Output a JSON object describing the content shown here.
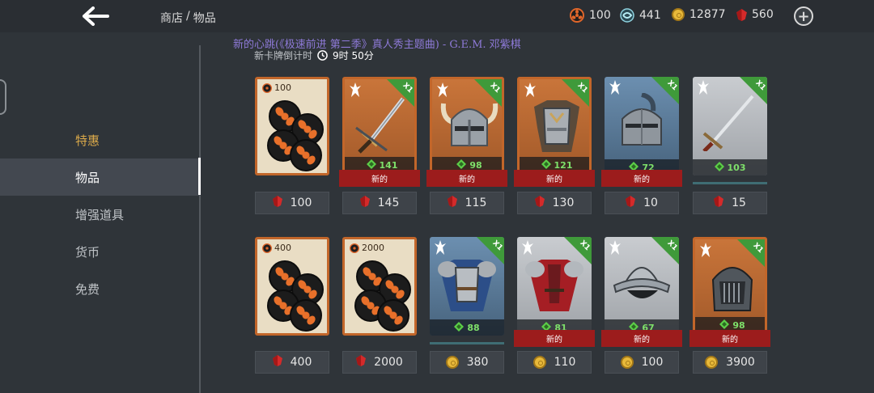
{
  "header": {
    "breadcrumb_shop": "商店",
    "breadcrumb_sep": "/",
    "breadcrumb_items": "物品",
    "currencies": [
      {
        "name": "raid-token",
        "icon": "orange-emblem-icon",
        "value": "100"
      },
      {
        "name": "swirl-token",
        "icon": "teal-swirl-icon",
        "value": "441"
      },
      {
        "name": "gold",
        "icon": "gold-coin-icon",
        "value": "12877"
      },
      {
        "name": "ruby",
        "icon": "ruby-gem-icon",
        "value": "560"
      }
    ],
    "add_label": "+"
  },
  "now_playing": "新的心跳(《极速前进 第二季》真人秀主题曲) - G.E.M. 邓紫棋",
  "timer": {
    "label": "新卡牌倒计时",
    "value": "9时 50分"
  },
  "sidebar": {
    "items": [
      {
        "label": "特惠"
      },
      {
        "label": "物品"
      },
      {
        "label": "增强道具"
      },
      {
        "label": "货币"
      },
      {
        "label": "免费"
      }
    ]
  },
  "cards": [
    {
      "type": "coin",
      "amount": "100",
      "price": "100",
      "currency": "ruby"
    },
    {
      "type": "orange",
      "art": "sword-icon",
      "power": "141",
      "badge": "X1",
      "new_label": "新的",
      "price": "145",
      "currency": "ruby"
    },
    {
      "type": "orange",
      "art": "horned-helmet-icon",
      "power": "98",
      "badge": "X1",
      "new_label": "新的",
      "price": "115",
      "currency": "ruby"
    },
    {
      "type": "orange",
      "art": "armor-icon",
      "power": "121",
      "badge": "X1",
      "new_label": "新的",
      "price": "130",
      "currency": "ruby"
    },
    {
      "type": "blue",
      "art": "crested-helmet-icon",
      "power": "72",
      "badge": "X1",
      "new_label": "新的",
      "price": "10",
      "currency": "ruby"
    },
    {
      "type": "white",
      "art": "longsword-icon",
      "power": "103",
      "badge": "X1",
      "price": "15",
      "currency": "ruby"
    },
    {
      "type": "coin",
      "amount": "400",
      "price": "400",
      "currency": "ruby"
    },
    {
      "type": "coin",
      "amount": "2000",
      "price": "2000",
      "currency": "ruby"
    },
    {
      "type": "blue",
      "art": "blue-armor-icon",
      "power": "88",
      "badge": "X1",
      "price": "380",
      "currency": "gold"
    },
    {
      "type": "white",
      "art": "red-armor-icon",
      "power": "81",
      "badge": "X1",
      "new_label": "新的",
      "price": "110",
      "currency": "gold"
    },
    {
      "type": "white",
      "art": "kettle-helmet-icon",
      "power": "67",
      "badge": "X1",
      "new_label": "新的",
      "price": "100",
      "currency": "gold"
    },
    {
      "type": "orange",
      "art": "great-helm-icon",
      "power": "98",
      "badge": "X1",
      "new_label": "新的",
      "price": "3900",
      "currency": "gold"
    }
  ],
  "colors": {
    "accent_gold": "#d9a84a",
    "new_red": "#9c1c1c",
    "power_green": "#7ee06a",
    "rarity_orange": "#c2662a"
  }
}
